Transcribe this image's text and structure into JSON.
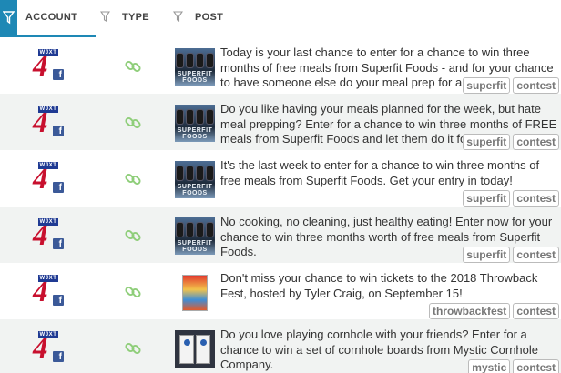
{
  "table": {
    "filter_icon": "filter-funnel-icon",
    "columns": [
      {
        "key": "account",
        "label": "ACCOUNT"
      },
      {
        "key": "type",
        "label": "TYPE"
      },
      {
        "key": "post",
        "label": "POST"
      }
    ]
  },
  "brand": {
    "accent": "#1e88b5",
    "account_logo_text": "WJXT",
    "account_logo_number": "4",
    "social": "f"
  },
  "rows": [
    {
      "type_icon": "link-icon",
      "thumb": "superfit-foods",
      "thumb_text": "SUPERFIT FOODS",
      "text": "Today is your last chance to enter for a chance to win three months of free meals from Superfit Foods - and for your chance to have someone else do your meal prep for a month!",
      "tags": [
        "superfit",
        "contest"
      ]
    },
    {
      "type_icon": "link-icon",
      "thumb": "superfit-foods",
      "thumb_text": "SUPERFIT FOODS",
      "text": "Do you like having your meals planned for the week, but hate meal prepping? Enter for a chance to win three months of FREE meals from Superfit Foods and let them do it for you!",
      "tags": [
        "superfit",
        "contest"
      ]
    },
    {
      "type_icon": "link-icon",
      "thumb": "superfit-foods",
      "thumb_text": "SUPERFIT FOODS",
      "text": "It's the last week to enter for a chance to win three months of free meals from Superfit Foods. Get your entry in today!",
      "tags": [
        "superfit",
        "contest"
      ]
    },
    {
      "type_icon": "link-icon",
      "thumb": "superfit-foods",
      "thumb_text": "SUPERFIT FOODS",
      "text": "No cooking, no cleaning, just healthy eating! Enter now for your chance to win three months worth of free meals from Superfit Foods.",
      "tags": [
        "superfit",
        "contest"
      ]
    },
    {
      "type_icon": "link-icon",
      "thumb": "throwback-fest-poster",
      "thumb_text": "",
      "text": "Don't miss your chance to win tickets to the 2018 Throwback Fest, hosted by Tyler Craig, on September 15!",
      "tags": [
        "throwbackfest",
        "contest"
      ]
    },
    {
      "type_icon": "link-icon",
      "thumb": "cornhole-boards",
      "thumb_text": "",
      "text": "Do you love playing cornhole with your friends? Enter for a chance to win a set of cornhole boards from Mystic Cornhole Company.",
      "tags": [
        "mystic",
        "contest"
      ]
    }
  ]
}
